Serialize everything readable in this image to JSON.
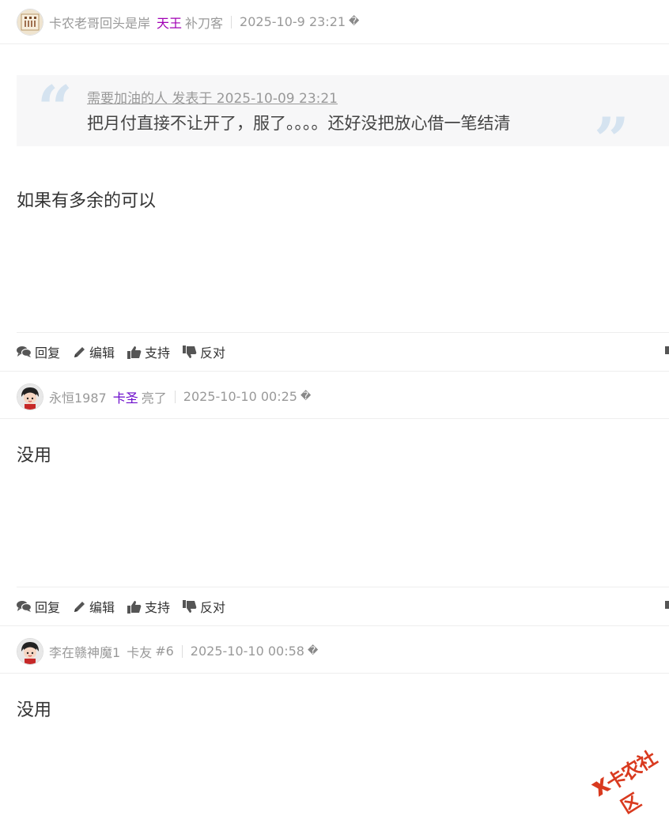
{
  "posts": [
    {
      "username": "卡农老哥回头是岸",
      "group": "天王",
      "group_color": "#a000b4",
      "title": "补刀客",
      "date": "2025-10-9 23:21",
      "date_icon": "�",
      "quote": {
        "meta": "需要加油的人 发表于 2025-10-09 23:21",
        "text": "把月付直接不让开了，服了。。。。还好没把放心借一笔结清"
      },
      "content": "如果有多余的可以"
    },
    {
      "username": "永恒1987",
      "group": "卡圣",
      "group_color": "#6a0acb",
      "title": "亮了",
      "date": "2025-10-10 00:25",
      "date_icon": "�",
      "content": "没用"
    },
    {
      "username": "李在赣神魔1",
      "group": "卡友",
      "group_color": "#999999",
      "title": "#6",
      "date": "2025-10-10 00:58",
      "date_icon": "�",
      "content": "没用"
    }
  ],
  "actions": {
    "reply": "回复",
    "edit": "编辑",
    "support": "支持",
    "oppose": "反对"
  },
  "logo": {
    "text": "卡农社区"
  },
  "icons": [
    "comments-icon",
    "pencil-icon",
    "thumbs-up-icon",
    "thumbs-down-icon"
  ],
  "colors": {
    "border": "#eeeeee",
    "meta_text": "#999999",
    "quote_bg": "#f7f7f8",
    "logo_red": "#d93a1f"
  }
}
